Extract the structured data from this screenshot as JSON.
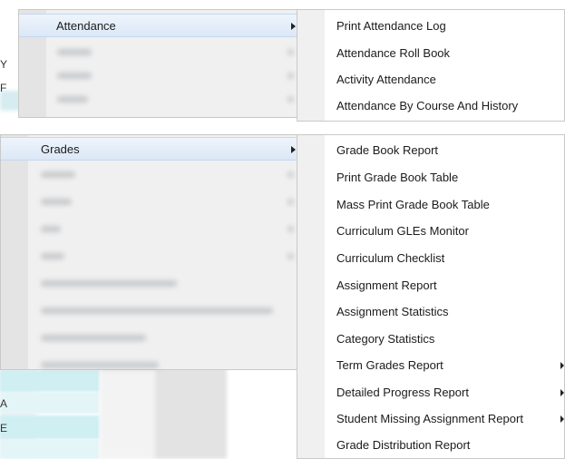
{
  "attendance_menu": {
    "label": "Attendance",
    "submenu": [
      "Print Attendance Log",
      "Attendance Roll Book",
      "Activity Attendance",
      "Attendance By Course And History"
    ]
  },
  "grades_menu": {
    "label": "Grades",
    "submenu": [
      "Grade Book Report",
      "Print Grade Book Table",
      "Mass Print Grade Book Table",
      "Curriculum GLEs Monitor",
      "Curriculum Checklist",
      "Assignment Report",
      "Assignment Statistics",
      "Category Statistics",
      "Term Grades Report",
      "Detailed Progress Report",
      "Student Missing Assignment Report",
      "Grade Distribution Report"
    ]
  },
  "edge_letters": [
    "Y",
    "F",
    "A",
    "E"
  ]
}
